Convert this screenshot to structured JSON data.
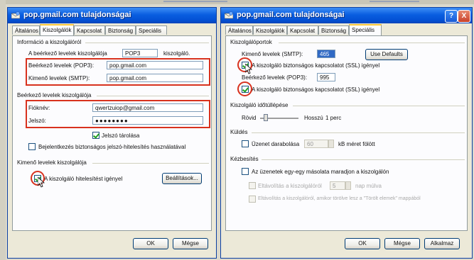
{
  "left_window": {
    "title": "pop.gmail.com tulajdonságai",
    "tabs": [
      "Általános",
      "Kiszolgálók",
      "Kapcsolat",
      "Biztonság",
      "Speciális"
    ],
    "server_info_group": "Információ a kiszolgálóról",
    "incoming_type_label": "A beérkező levelek kiszolgálója",
    "incoming_type_value": "POP3",
    "incoming_type_suffix": "kiszolgáló.",
    "incoming_label": "Beérkező levelek (POP3):",
    "incoming_value": "pop.gmail.com",
    "outgoing_label": "Kimenő levelek (SMTP):",
    "outgoing_value": "pop.gmail.com",
    "incoming_server_group": "Beérkező levelek kiszolgálója",
    "account_label": "Fióknév:",
    "account_value": "qwertzuiop@gmail.com",
    "password_label": "Jelszó:",
    "password_value": "●●●●●●●●",
    "remember_password_label": "Jelszó tárolása",
    "spa_label": "Bejelentkezés biztonságos jelszó-hitelesítés használatával",
    "outgoing_server_group": "Kimenő levelek kiszolgálója",
    "smtp_auth_label": "A kiszolgáló hitelesítést igényel",
    "settings_button": "Beállítások...",
    "ok_button": "OK",
    "cancel_button": "Mégse"
  },
  "right_window": {
    "title": "pop.gmail.com tulajdonságai",
    "help_glyph": "?",
    "close_glyph": "X",
    "tabs": [
      "Általános",
      "Kiszolgálók",
      "Kapcsolat",
      "Biztonság",
      "Speciális"
    ],
    "ports_group": "Kiszolgálóportok",
    "smtp_port_label": "Kimenő levelek (SMTP):",
    "smtp_port_value": "465",
    "use_defaults_button": "Use Defaults",
    "smtp_ssl_label": "A kiszolgáló biztonságos kapcsolatot (SSL) igényel",
    "pop3_port_label": "Beérkező levelek (POP3):",
    "pop3_port_value": "995",
    "pop3_ssl_label": "A kiszolgáló biztonságos kapcsolatot (SSL) igényel",
    "timeout_group": "Kiszolgáló időtúllépése",
    "timeout_short": "Rövid",
    "timeout_long": "Hosszú",
    "timeout_value": "1 perc",
    "timeout_fraction": 0.15,
    "sending_group": "Küldés",
    "split_label": "Üzenet darabolása",
    "split_value": "60",
    "split_suffix": "kB méret fölött",
    "delivery_group": "Kézbesítés",
    "leave_copy_label": "Az üzenetek egy-egy másolata maradjon a kiszolgálón",
    "remove_after_label": "Eltávolítás a kiszolgálóról",
    "remove_after_value": "5",
    "remove_after_suffix": "nap múlva",
    "remove_deleted_label": "Eltávolítás a kiszolgálóról, amikor törölve lesz a \"Törölt elemek\" mappából",
    "ok_button": "OK",
    "cancel_button": "Mégse",
    "apply_button": "Alkalmaz"
  }
}
